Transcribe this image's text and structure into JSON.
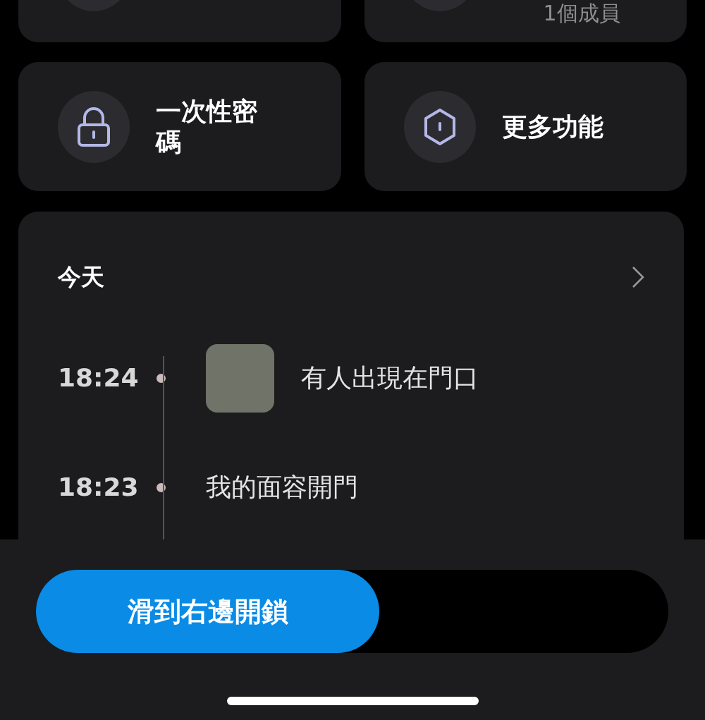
{
  "upper_tiles": [
    {
      "kind": "blank"
    },
    {
      "kind": "subtitle",
      "subtitle": "1個成員"
    }
  ],
  "tiles": [
    {
      "label": "一次性密碼",
      "kind": "lock"
    },
    {
      "label": "更多功能",
      "kind": "hexagon"
    }
  ],
  "activity": {
    "heading": "今天",
    "events": [
      {
        "time": "18:24",
        "text": "有人出現在門口",
        "kind": "snapshot"
      },
      {
        "time": "18:23",
        "text": "我的面容開門",
        "kind": "text"
      }
    ]
  },
  "unlock_slider": {
    "label": "滑到右邊開鎖"
  }
}
